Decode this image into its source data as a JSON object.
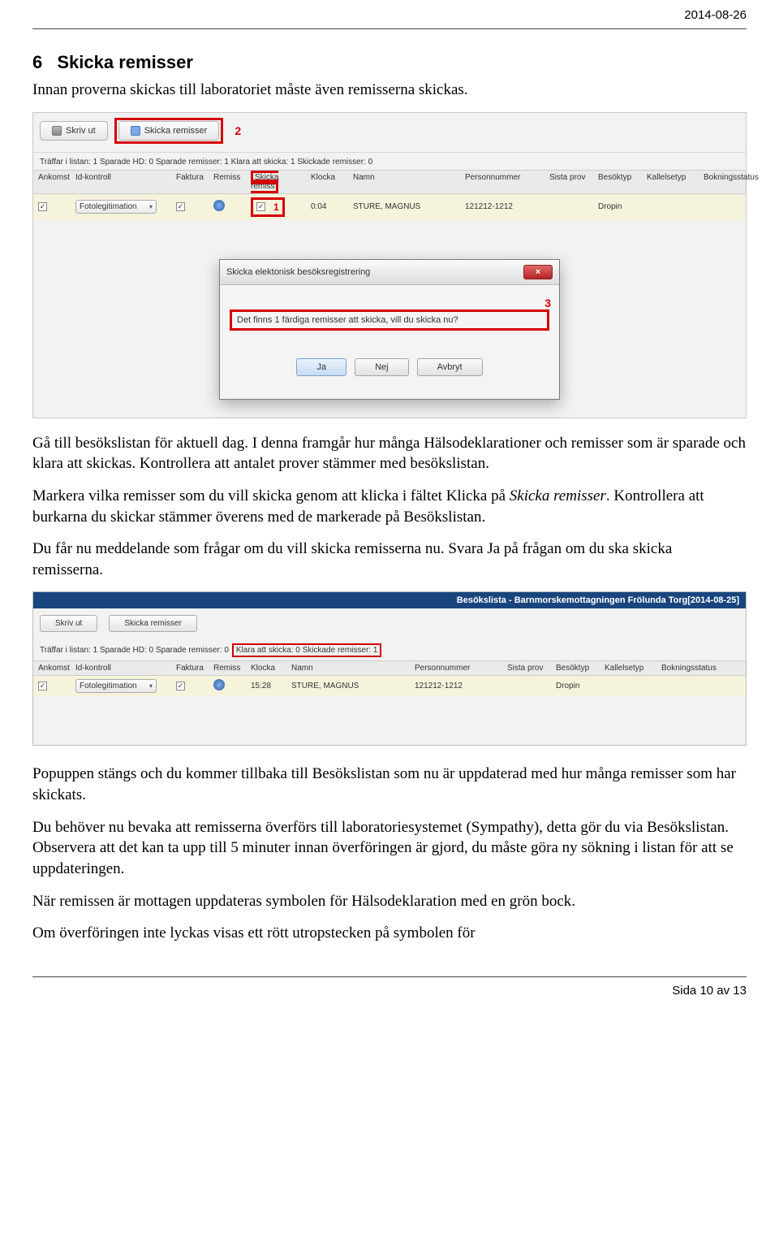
{
  "header": {
    "date": "2014-08-26"
  },
  "section": {
    "number": "6",
    "title": "Skicka remisser"
  },
  "paragraphs": {
    "p1": "Innan proverna skickas till laboratoriet måste även remisserna skickas.",
    "p2a": "Gå till besökslistan för aktuell dag. I denna framgår hur många Hälsodeklarationer och remisser som är sparade och klara att skickas. Kontrollera att antalet prover stämmer med besökslistan.",
    "p2b_pre": "Markera vilka remisser som du vill skicka genom att klicka i fältet Klicka på ",
    "p2b_italic": "Skicka remisser",
    "p2b_post": ". Kontrollera att burkarna du skickar stämmer överens med de markerade på Besökslistan.",
    "p2c": "Du får nu meddelande som frågar om du vill skicka remisserna nu. Svara Ja på frågan om du ska skicka remisserna.",
    "p3": "Popuppen stängs och du kommer tillbaka till Besökslistan som nu är uppdaterad med hur många remisser som har skickats.",
    "p4": "Du behöver nu bevaka att remisserna överförs till laboratoriesystemet (Sympathy), detta gör du via Besökslistan. Observera att det kan ta upp till 5 minuter innan överföringen är gjord, du måste göra ny sökning i listan för att se uppdateringen.",
    "p5": "När remissen är mottagen uppdateras symbolen för Hälsodeklaration med en grön bock.",
    "p6": "Om överföringen inte lyckas visas ett rött utropstecken på symbolen för"
  },
  "shot1": {
    "btn_print": "Skriv ut",
    "btn_send": "Skicka remisser",
    "red2": "2",
    "stats": "Träffar i listan:  1   Sparade HD:  0   Sparade remisser:  1   Klara att skicka:  1   Skickade remisser:  0",
    "cols": [
      "Ankomst",
      "Id-kontroll",
      "Faktura",
      "Remiss",
      "Skicka remiss",
      "Klocka",
      "Namn",
      "Personnummer",
      "Sista prov",
      "Besöktyp",
      "Kallelsetyp",
      "Bokningsstatus"
    ],
    "row": {
      "id_kontroll_value": "Fotolegitimation",
      "klocka": "0:04",
      "namn": "STURE, MAGNUS",
      "personnummer": "121212-1212",
      "besoktyp": "Dropin"
    },
    "red1": "1"
  },
  "dialog": {
    "title": "Skicka elektonisk besöksregistrering",
    "red3": "3",
    "message": "Det finns 1 färdiga remisser att skicka, vill du skicka nu?",
    "btn_yes": "Ja",
    "btn_no": "Nej",
    "btn_cancel": "Avbryt"
  },
  "shot2": {
    "window_title": "Besökslista - Barnmorskemottagningen Frölunda Torg[2014-08-25]",
    "btn_print": "Skriv ut",
    "btn_send": "Skicka remisser",
    "stats_pre": "Träffar i listan:  1   Sparade HD:  0   Sparade remisser:  0",
    "stats_red": "Klara att skicka:  0   Skickade remisser:  1",
    "cols": [
      "Ankomst",
      "Id-kontroll",
      "Faktura",
      "Remiss",
      "Klocka",
      "Namn",
      "Personnummer",
      "Sista prov",
      "Besöktyp",
      "Kallelsetyp",
      "Bokningsstatus"
    ],
    "row": {
      "id_kontroll_value": "Fotolegitimation",
      "klocka": "15:28",
      "namn": "STURE, MAGNUS",
      "personnummer": "121212-1212",
      "besoktyp": "Dropin"
    }
  },
  "footer": {
    "text": "Sida 10 av 13"
  }
}
